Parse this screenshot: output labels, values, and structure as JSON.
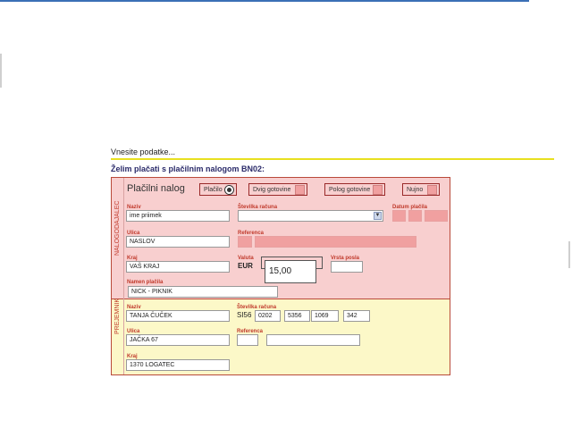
{
  "page": {
    "intro": "Vnesite podatke...",
    "heading": "Želim plačati s plačilnim nalogom BN02:"
  },
  "form": {
    "title": "Plačilni nalog",
    "buttons": [
      {
        "label": "Plačilo",
        "selected": true
      },
      {
        "label": "Dvig gotovine"
      },
      {
        "label": "Polog gotovine"
      },
      {
        "label": "Nujno"
      }
    ],
    "payer": {
      "section_label": "NALOGODAJALEC",
      "name_label": "Naziv",
      "name_value": "ime priimek",
      "account_label": "Številka računa",
      "date_label": "Datum plačila",
      "street_label": "Ulica",
      "street_value": "NASLOV",
      "reference_label": "Referenca",
      "city_label": "Kraj",
      "city_value": "VAŠ KRAJ",
      "currency_label": "Valuta",
      "currency_value": "EUR",
      "amount_value": "15,00",
      "purpose_code_label": "Vrsta posla",
      "purpose_label": "Namen plačila",
      "purpose_value": "NICK - PIKNIK"
    },
    "payee": {
      "section_label": "PREJEMNIK",
      "name_label": "Naziv",
      "name_value": "TANJA ČUČEK",
      "account_label": "Številka računa",
      "account_prefix": "SI56",
      "account_parts": [
        "0202",
        "5356",
        "1069",
        "342"
      ],
      "street_label": "Ulica",
      "street_value": "JAČKA 67",
      "reference_label": "Referenca",
      "city_label": "Kraj",
      "city_value": "1370 LOGATEC"
    }
  },
  "colors": {
    "payer_bg": "#f8cfcf",
    "payee_bg": "#fcf8c8",
    "label_red": "#c0392b",
    "accent_yellow": "#e8e020"
  }
}
